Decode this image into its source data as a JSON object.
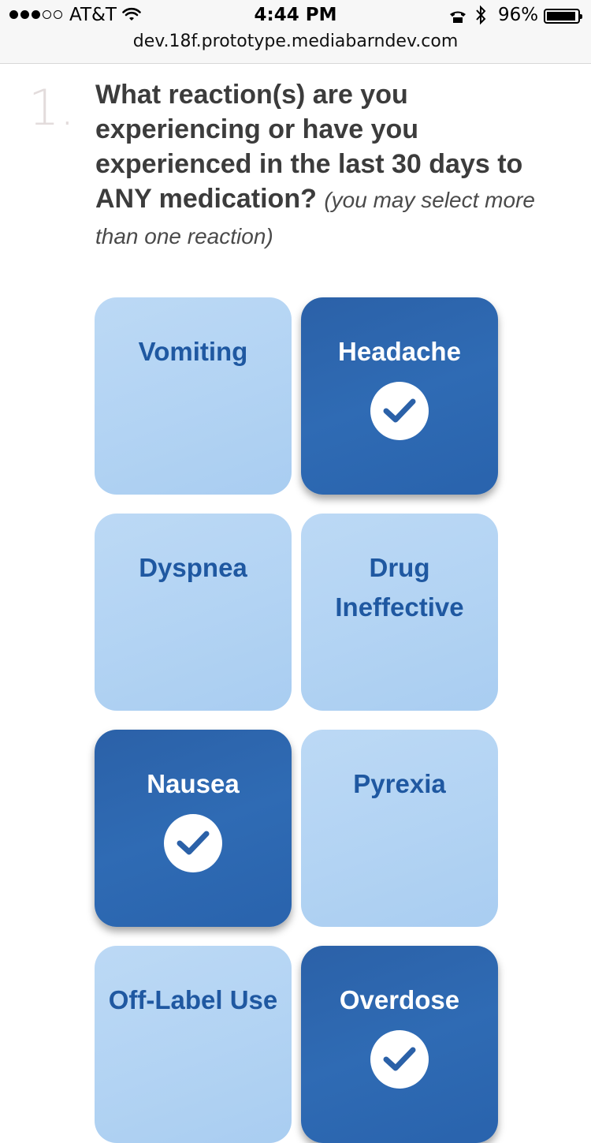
{
  "status_bar": {
    "carrier": "AT&T",
    "time": "4:44 PM",
    "battery": "96%",
    "battery_level": 0.96,
    "signal_bars_filled": 3,
    "signal_bars_total": 5
  },
  "browser": {
    "url": "dev.18f.prototype.mediabarndev.com"
  },
  "question": {
    "number": "1.",
    "text": "What reaction(s) are you experiencing or have you experienced in the last 30 days to ANY medication?",
    "hint": "(you may select more than one reaction)"
  },
  "reactions": [
    {
      "label": "Vomiting",
      "selected": false
    },
    {
      "label": "Headache",
      "selected": true
    },
    {
      "label": "Dyspnea",
      "selected": false
    },
    {
      "label": "Drug Ineffective",
      "selected": false
    },
    {
      "label": "Nausea",
      "selected": true
    },
    {
      "label": "Pyrexia",
      "selected": false
    },
    {
      "label": "Off-Label Use",
      "selected": false
    },
    {
      "label": "Overdose",
      "selected": true
    }
  ],
  "colors": {
    "tile_unselected": "#b2d3f3",
    "tile_selected": "#2b61a8",
    "label_unselected": "#1f58a1",
    "label_selected": "#ffffff",
    "question_text": "#3c3c3c",
    "question_number": "#e3dcdc"
  },
  "icons": {
    "check": "check-icon",
    "wifi": "wifi-icon",
    "bluetooth": "bluetooth-icon",
    "phone": "phone-icon",
    "battery": "battery-icon"
  }
}
